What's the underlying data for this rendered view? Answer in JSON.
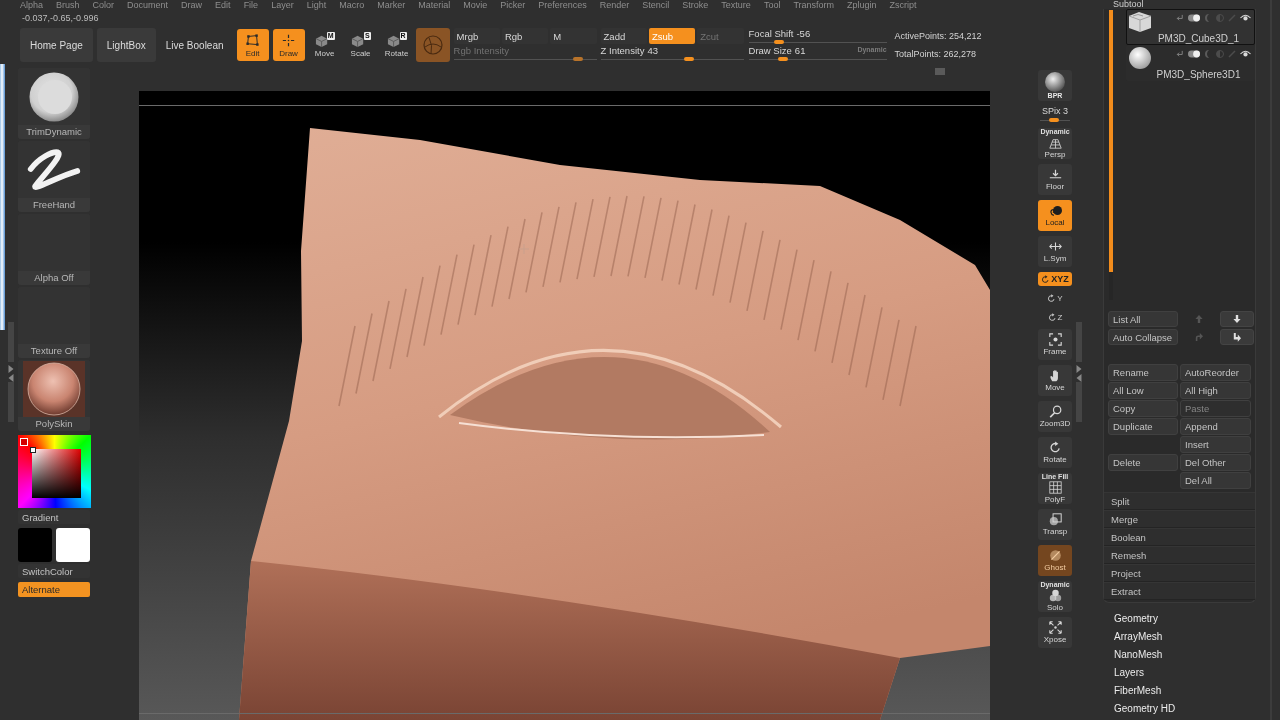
{
  "menu_bar": [
    "Alpha",
    "Brush",
    "Color",
    "Document",
    "Draw",
    "Edit",
    "File",
    "Layer",
    "Light",
    "Macro",
    "Marker",
    "Material",
    "Movie",
    "Picker",
    "Preferences",
    "Render",
    "Stencil",
    "Stroke",
    "Texture",
    "Tool",
    "Transform",
    "Zplugin",
    "Zscript"
  ],
  "coordinates": "-0.037,-0.65,-0.996",
  "toolbar": {
    "buttons": [
      {
        "label": "Home Page",
        "kind": "panel"
      },
      {
        "label": "LightBox",
        "kind": "panel"
      },
      {
        "label": "Live Boolean",
        "kind": "plain"
      }
    ],
    "modes": [
      {
        "label": "Edit",
        "selected": true
      },
      {
        "label": "Draw",
        "selected": true
      },
      {
        "label": "Move",
        "key": "M",
        "selected": false
      },
      {
        "label": "Scale",
        "key": "S",
        "selected": false
      },
      {
        "label": "Rotate",
        "key": "R",
        "selected": false
      }
    ],
    "groups": [
      {
        "buttons": [
          {
            "label": "Mrgb",
            "selected": false,
            "disabled": false
          },
          {
            "label": "Rgb",
            "selected": false,
            "disabled": false
          },
          {
            "label": "M",
            "selected": false,
            "disabled": false
          }
        ],
        "slider": {
          "label": "Rgb Intensity",
          "disabled": true,
          "level": 0.9
        }
      },
      {
        "buttons": [
          {
            "label": "Zadd",
            "selected": false,
            "disabled": false
          },
          {
            "label": "Zsub",
            "selected": true,
            "disabled": false
          },
          {
            "label": "Zcut",
            "selected": false,
            "disabled": true
          }
        ],
        "slider": {
          "label": "Z Intensity",
          "value": "43",
          "disabled": false,
          "level": 0.63
        }
      }
    ],
    "sliders": [
      {
        "label": "Focal Shift",
        "value": "-56",
        "level": 0.2
      },
      {
        "label": "Draw Size",
        "value": "61",
        "level": 0.23,
        "tag": "Dynamic"
      }
    ],
    "stats": [
      "ActivePoints: 254,212",
      "TotalPoints: 262,278"
    ]
  },
  "left_panel": {
    "selectors": [
      {
        "kind": "brush",
        "label": "TrimDynamic"
      },
      {
        "kind": "stroke",
        "label": "FreeHand"
      },
      {
        "kind": "alpha",
        "label": "Alpha Off"
      },
      {
        "kind": "texture",
        "label": "Texture Off"
      },
      {
        "kind": "material",
        "label": "PolySkin"
      }
    ],
    "gradient": {
      "label": "Gradient",
      "selected": false
    },
    "swatches": [
      {
        "color": "#000000"
      },
      {
        "color": "#ffffff"
      }
    ],
    "switch_color": "SwitchColor",
    "alternate": {
      "label": "Alternate",
      "selected": true
    }
  },
  "view_tools": [
    {
      "kind": "render",
      "label": "BPR",
      "selected": false,
      "disabled": false
    },
    {
      "kind": "slider",
      "label": "SPix 3",
      "level": 0.43
    },
    {
      "kind": "button",
      "label": "Persp",
      "tag": "Dynamic",
      "selected": false,
      "disabled": false
    },
    {
      "kind": "button",
      "label": "Floor",
      "selected": false,
      "disabled": false
    },
    {
      "kind": "button",
      "label": "Local",
      "selected": true,
      "disabled": false
    },
    {
      "kind": "button",
      "label": "L.Sym",
      "selected": false,
      "disabled": false
    },
    {
      "kind": "pill",
      "label": "XYZ",
      "selected": true,
      "disabled": false
    },
    {
      "kind": "axis",
      "label": "Y",
      "selected": false,
      "disabled": false
    },
    {
      "kind": "axis",
      "label": "Z",
      "selected": false,
      "disabled": false
    },
    {
      "kind": "button",
      "label": "Frame",
      "selected": false,
      "disabled": false
    },
    {
      "kind": "button",
      "label": "Move",
      "selected": false,
      "disabled": false
    },
    {
      "kind": "button",
      "label": "Zoom3D",
      "selected": false,
      "disabled": false
    },
    {
      "kind": "button",
      "label": "Rotate",
      "selected": false,
      "disabled": false
    },
    {
      "kind": "button",
      "label": "PolyF",
      "tag": "Line Fill",
      "selected": false,
      "disabled": false
    },
    {
      "kind": "button",
      "label": "Transp",
      "selected": false,
      "disabled": false
    },
    {
      "kind": "button",
      "label": "Ghost",
      "selected": true,
      "disabled": true
    },
    {
      "kind": "button",
      "label": "Solo",
      "tag": "Dynamic",
      "selected": false,
      "disabled": false
    },
    {
      "kind": "button",
      "label": "Xpose",
      "selected": false,
      "disabled": false
    }
  ],
  "subtool": {
    "title": "Subtool",
    "items": [
      {
        "name": "PM3D_Cube3D_1",
        "kind": "cube",
        "selected": true,
        "visible": true
      },
      {
        "name": "PM3D_Sphere3D1",
        "kind": "sphere",
        "selected": false,
        "visible": true
      }
    ],
    "list_rows": [
      {
        "label": "List All",
        "arrows": [
          {
            "disabled": true
          },
          {
            "disabled": false
          }
        ]
      },
      {
        "label": "Auto Collapse",
        "arrows": [
          {
            "disabled": true
          },
          {
            "disabled": false
          }
        ]
      }
    ],
    "grid": [
      {
        "left": {
          "label": "Rename",
          "disabled": false
        },
        "right": [
          {
            "label": "AutoReorder",
            "disabled": false
          }
        ]
      },
      {
        "left": {
          "label": "All Low",
          "disabled": false
        },
        "right": [
          {
            "label": "All High",
            "disabled": false
          }
        ]
      },
      {
        "left": {
          "label": "Copy",
          "disabled": false
        },
        "right": [
          {
            "label": "Paste",
            "disabled": true
          }
        ]
      },
      {
        "left": {
          "label": "Duplicate",
          "disabled": false
        },
        "right": [
          {
            "label": "Append",
            "disabled": false
          },
          {
            "label": "Insert",
            "disabled": false
          }
        ]
      },
      {
        "left": {
          "label": "Delete",
          "disabled": false
        },
        "right": [
          {
            "label": "Del Other",
            "disabled": false
          },
          {
            "label": "Del All",
            "disabled": false
          }
        ]
      }
    ],
    "actions": [
      "Split",
      "Merge",
      "Boolean",
      "Remesh",
      "Project",
      "Extract"
    ]
  },
  "palettes": [
    "Geometry",
    "ArrayMesh",
    "NanoMesh",
    "Layers",
    "FiberMesh",
    "Geometry HD"
  ]
}
